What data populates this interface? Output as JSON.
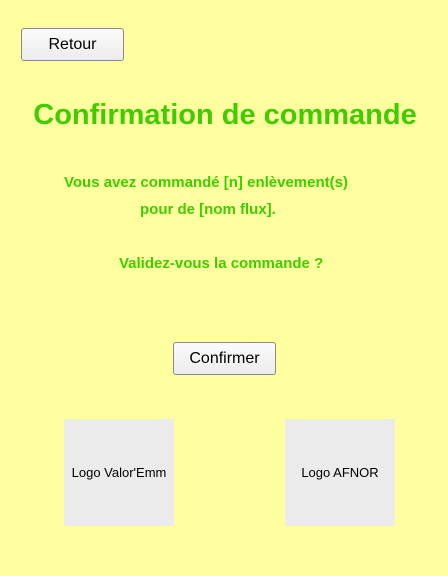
{
  "toolbar": {
    "back_label": "Retour"
  },
  "main": {
    "title": "Confirmation de commande",
    "message_line1": "Vous avez commandé [n] enlèvement(s)",
    "message_line2": "pour de [nom flux].",
    "question": "Validez-vous la commande ?",
    "confirm_label": "Confirmer"
  },
  "logos": {
    "left": "Logo Valor'Emm",
    "right": "Logo AFNOR"
  },
  "colors": {
    "background": "#ffff9f",
    "accent": "#3fcc00",
    "logo_placeholder": "#ebebeb"
  }
}
